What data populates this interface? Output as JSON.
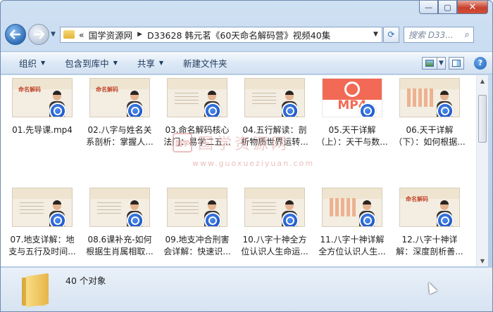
{
  "window": {
    "controls": {
      "minimize": "—",
      "maximize": "▢",
      "close": "✕"
    }
  },
  "nav": {
    "overflow": "«",
    "breadcrumb": [
      "国学资源网",
      "D33628 韩元茗《60天命名解码营》视频40集"
    ],
    "search_placeholder": "搜索 D33..."
  },
  "toolbar": {
    "organize": "组织",
    "include_in_library": "包含到库中",
    "share": "共享",
    "new_folder": "新建文件夹"
  },
  "thumb_text": {
    "title": "命名解码",
    "mp4": "MP4"
  },
  "files": [
    {
      "name": "01.先导课.mp4",
      "thumb": "title"
    },
    {
      "name": "02.八字与姓名关系剖析：掌握人...",
      "thumb": "title"
    },
    {
      "name": "03.命名解码核心法门：易学二五...",
      "thumb": "slide"
    },
    {
      "name": "04.五行解读：剖析物质世界运转...",
      "thumb": "slide"
    },
    {
      "name": "05.天干详解（上）：天干与数...",
      "thumb": "mp4"
    },
    {
      "name": "06.天干详解（下）：如何根据...",
      "thumb": "grid"
    },
    {
      "name": "07.地支详解：地支与五行及时间...",
      "thumb": "slide"
    },
    {
      "name": "08.6课补充-如何根据生肖属相取...",
      "thumb": "slide"
    },
    {
      "name": "09.地支冲合刑害会详解：快速识...",
      "thumb": "slide"
    },
    {
      "name": "10.八字十神全方位认识人生命运...",
      "thumb": "slide"
    },
    {
      "name": "11.八字十神详解全方位认识人生...",
      "thumb": "grid"
    },
    {
      "name": "12.八字十神详解：深度剖析善...",
      "thumb": "title"
    }
  ],
  "watermark": {
    "text": "国学资源网",
    "url": "www.guoxueziyuan.com",
    "seal": "国学"
  },
  "status": {
    "count": "40 个对象"
  }
}
